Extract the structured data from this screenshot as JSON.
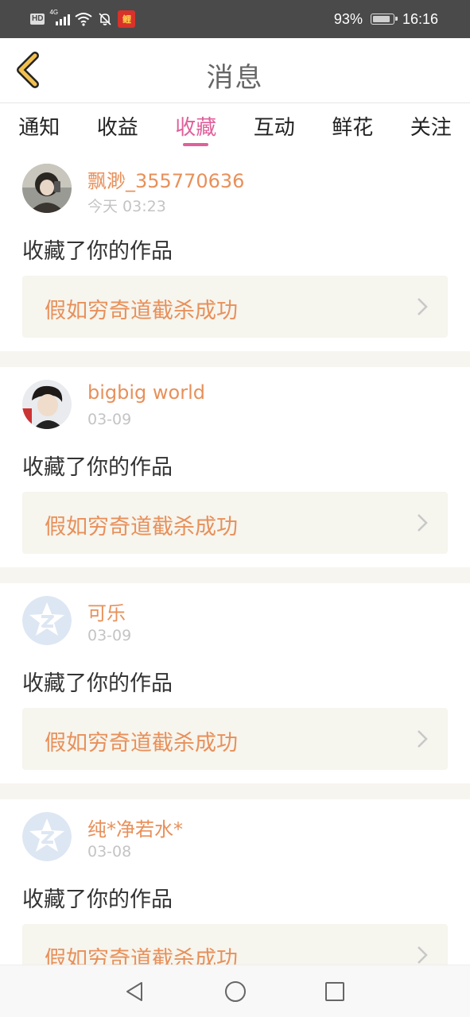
{
  "status_bar": {
    "network_badge": "HD",
    "signal_type": "4G",
    "app_icon_char": "鲤",
    "battery_percent": "93%",
    "battery_level": 0.93,
    "time": "16:16"
  },
  "header": {
    "title": "消息"
  },
  "tabs": [
    {
      "label": "通知",
      "active": false
    },
    {
      "label": "收益",
      "active": false
    },
    {
      "label": "收藏",
      "active": true
    },
    {
      "label": "互动",
      "active": false
    },
    {
      "label": "鲜花",
      "active": false
    },
    {
      "label": "关注",
      "active": false
    }
  ],
  "colors": {
    "accent": "#e0609b",
    "username": "#e8905a",
    "back_icon": "#f2c14e"
  },
  "messages": [
    {
      "username": "飘渺_355770636",
      "time": "今天 03:23",
      "action": "收藏了你的作品",
      "work_title": "假如穷奇道截杀成功",
      "avatar_type": "photo-1"
    },
    {
      "username": "bigbig world",
      "time": "03-09",
      "action": "收藏了你的作品",
      "work_title": "假如穷奇道截杀成功",
      "avatar_type": "photo-2"
    },
    {
      "username": "可乐",
      "time": "03-09",
      "action": "收藏了你的作品",
      "work_title": "假如穷奇道截杀成功",
      "avatar_type": "default-qq"
    },
    {
      "username": "纯*净若水*",
      "time": "03-08",
      "action": "收藏了你的作品",
      "work_title": "假如穷奇道截杀成功",
      "avatar_type": "default-qq"
    }
  ],
  "nav": {
    "back_icon": "triangle-back-icon",
    "home_icon": "circle-home-icon",
    "recents_icon": "square-recents-icon"
  }
}
